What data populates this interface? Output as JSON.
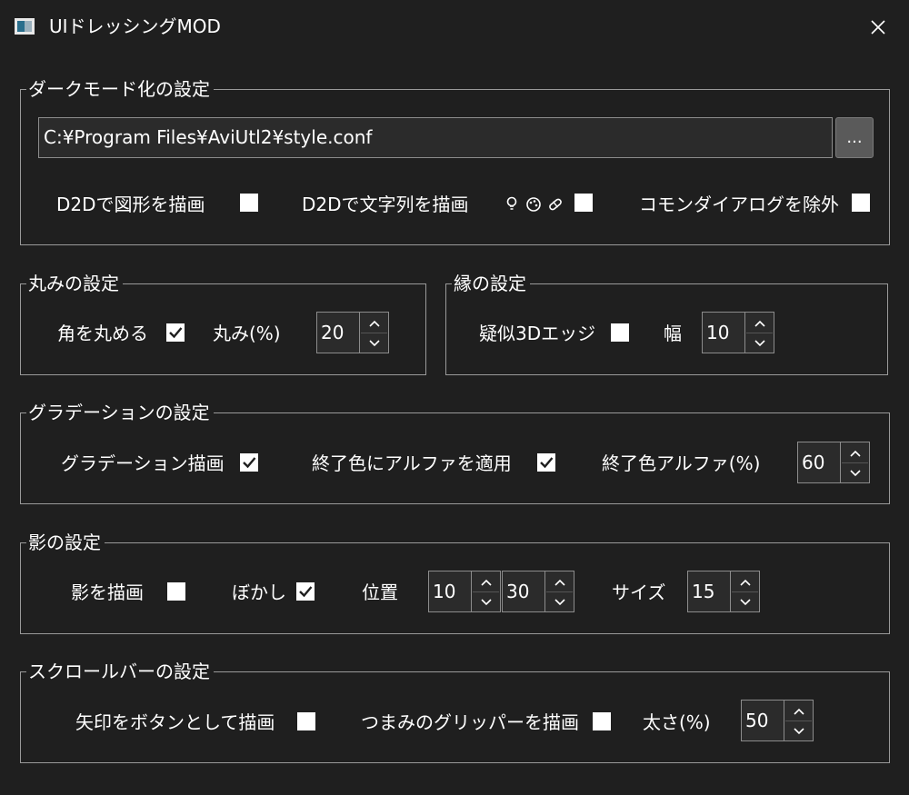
{
  "window": {
    "title": "UIドレッシングMOD",
    "icon": "app-window-icon",
    "close_icon": "close-icon"
  },
  "dark_mode": {
    "legend": "ダークモード化の設定",
    "path_value": "C:¥Program Files¥AviUtl2¥style.conf",
    "browse_label": "...",
    "d2d_shapes_label": "D2Dで図形を描画",
    "d2d_shapes_checked": false,
    "d2d_text_label": "D2Dで文字列を描画",
    "d2d_text_emoji": [
      "bulb-emoji",
      "palette-emoji",
      "pill-emoji"
    ],
    "d2d_text_checked": false,
    "exclude_common_dialog_label": "コモンダイアログを除外",
    "exclude_common_dialog_checked": false
  },
  "round": {
    "legend": "丸みの設定",
    "round_corners_label": "角を丸める",
    "round_corners_checked": true,
    "roundness_label": "丸み(%)",
    "roundness_value": "20"
  },
  "border": {
    "legend": "縁の設定",
    "pseudo3d_label": "疑似3Dエッジ",
    "pseudo3d_checked": false,
    "width_label": "幅",
    "width_value": "10"
  },
  "gradient": {
    "legend": "グラデーションの設定",
    "draw_label": "グラデーション描画",
    "draw_checked": true,
    "apply_alpha_label": "終了色にアルファを適用",
    "apply_alpha_checked": true,
    "end_alpha_label": "終了色アルファ(%)",
    "end_alpha_value": "60"
  },
  "shadow": {
    "legend": "影の設定",
    "draw_label": "影を描画",
    "draw_checked": false,
    "blur_label": "ぼかし",
    "blur_checked": true,
    "position_label": "位置",
    "position_x": "10",
    "position_y": "30",
    "size_label": "サイズ",
    "size_value": "15"
  },
  "scrollbar": {
    "legend": "スクロールバーの設定",
    "arrow_as_button_label": "矢印をボタンとして描画",
    "arrow_as_button_checked": false,
    "gripper_label": "つまみのグリッパーを描画",
    "gripper_checked": false,
    "thickness_label": "太さ(%)",
    "thickness_value": "50"
  }
}
